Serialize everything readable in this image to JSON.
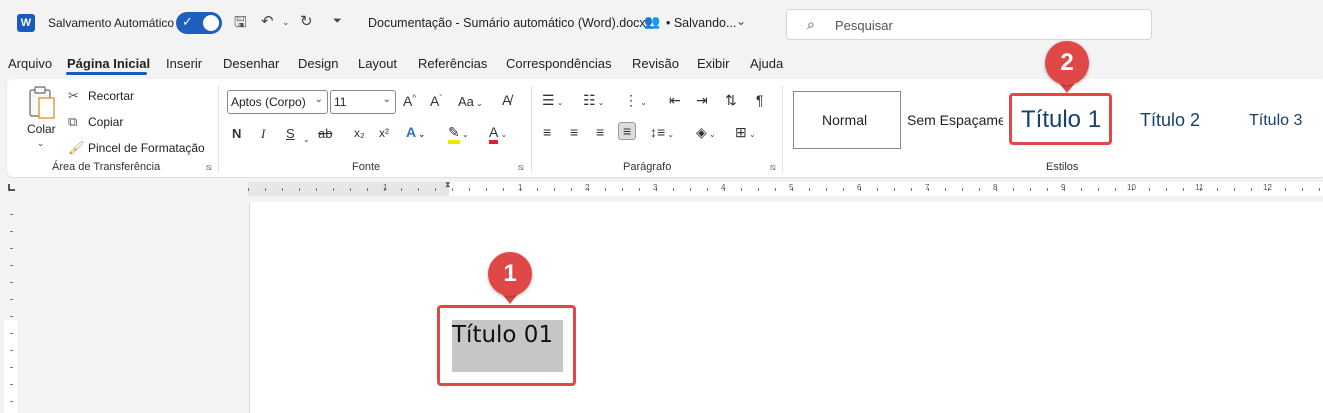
{
  "titlebar": {
    "app_icon": "W",
    "autosave_label": "Salvamento Automático",
    "autosave_on": true,
    "document_title": "Documentação - Sumário automático (Word).docx",
    "save_status": "• Salvando...",
    "search_placeholder": "Pesquisar"
  },
  "tabs": [
    "Arquivo",
    "Página Inicial",
    "Inserir",
    "Desenhar",
    "Design",
    "Layout",
    "Referências",
    "Correspondências",
    "Revisão",
    "Exibir",
    "Ajuda"
  ],
  "active_tab": "Página Inicial",
  "ribbon": {
    "clipboard": {
      "paste_label": "Colar",
      "cut_label": "Recortar",
      "copy_label": "Copiar",
      "format_painter_label": "Pincel de Formatação",
      "group_label": "Área de Transferência"
    },
    "font": {
      "font_name": "Aptos (Corpo)",
      "font_size": "11",
      "bold": "N",
      "italic": "I",
      "underline": "S",
      "case_label": "Aa",
      "grow": "A",
      "shrink": "A",
      "subscript": "x₂",
      "superscript": "x²",
      "effects": "A",
      "font_color": "A",
      "group_label": "Fonte"
    },
    "paragraph": {
      "group_label": "Parágrafo"
    },
    "styles": {
      "normal": "Normal",
      "no_spacing": "Sem Espaçame",
      "heading1": "Título 1",
      "heading2": "Título 2",
      "heading3": "Título 3",
      "group_label": "Estilos"
    }
  },
  "ruler": {
    "numbers": [
      "1",
      "1",
      "2",
      "3",
      "4",
      "5",
      "6",
      "7",
      "8",
      "9",
      "10",
      "11",
      "12"
    ]
  },
  "document": {
    "selected_text": "Título 01"
  },
  "callouts": {
    "one": "1",
    "two": "2"
  },
  "colors": {
    "accent": "#185abd",
    "callout": "#e04848",
    "selection": "#c6c6c6"
  }
}
